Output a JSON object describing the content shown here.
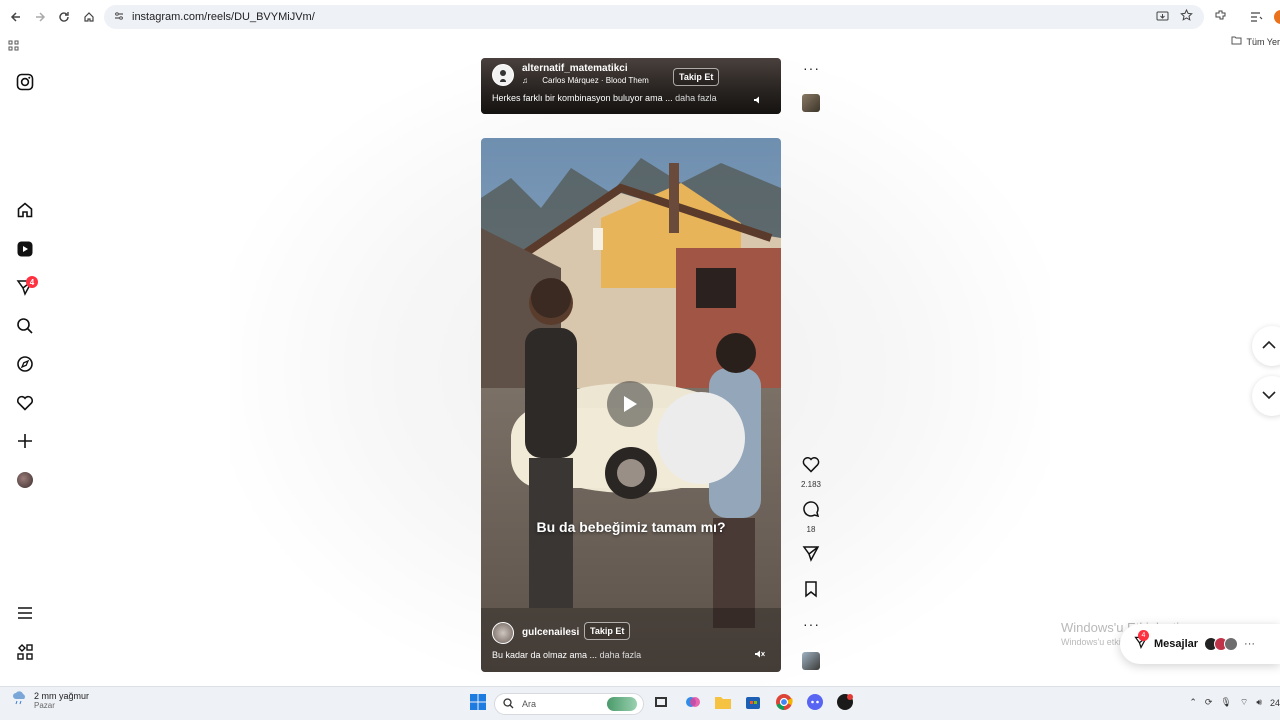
{
  "browser": {
    "url": "instagram.com/reels/DU_BVYMiJVm/",
    "bookmarks_folder": "Tüm Yer"
  },
  "sidebar": {
    "items": [
      "instagram-logo",
      "home",
      "reels",
      "messages",
      "search",
      "explore",
      "notifications",
      "create",
      "profile",
      "more",
      "apps"
    ],
    "messages_badge": "4"
  },
  "reels": [
    {
      "username": "alternatif_matematikci",
      "music": "Carlos Márquez · Blood Them",
      "follow_label": "Takip Et",
      "caption": "Herkes farklı bir kombinasyon buluyor ama ...",
      "more_label": "daha fazla"
    },
    {
      "username": "gulcenailesi",
      "follow_label": "Takip Et",
      "caption": "Bu kadar da olmaz ama ...",
      "more_label": "daha fazla",
      "overlay_text": "Bu da bebeğimiz tamam mı?",
      "likes": "2.183",
      "comments": "18"
    }
  ],
  "watermark": {
    "line1": "Windows'u Etkinleştir",
    "line2": "Windows'u etkinleştirmek için Ayarlar'a gidin."
  },
  "messages_panel": {
    "label": "Mesajlar",
    "badge": "4",
    "more": "···"
  },
  "taskbar": {
    "weather_line1": "2 mm yağmur",
    "weather_line2": "Pazar",
    "search_placeholder": "Ara",
    "clock_partial": "24"
  },
  "colors": {
    "notification_red": "#ff3040",
    "page_bg": "#ffffff",
    "taskbar_bg": "#eef1f6"
  }
}
